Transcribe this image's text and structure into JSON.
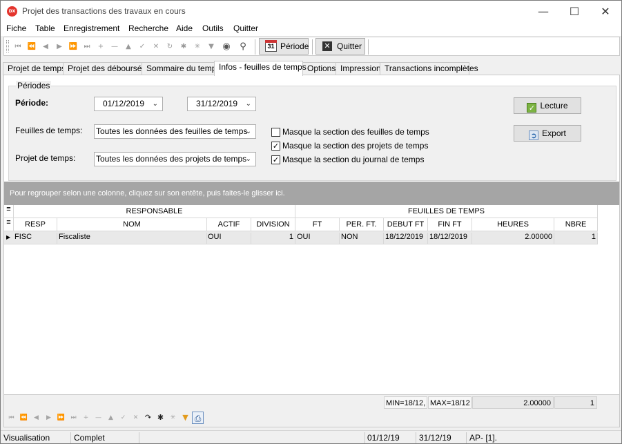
{
  "window": {
    "title": "Projet des transactions des travaux en cours",
    "icon_text": "DX"
  },
  "menu": [
    "Fiche",
    "Table",
    "Enregistrement",
    "Recherche",
    "Aide",
    "Outils",
    "Quitter"
  ],
  "toolbar": {
    "periode_label": "Période",
    "quitter_label": "Quitter",
    "calendar_day": "31"
  },
  "tabs": [
    "Projet de temps",
    "Projet des déboursés",
    "Sommaire du temps",
    "Infos - feuilles de temps",
    "Options",
    "Impression",
    "Transactions incomplètes"
  ],
  "active_tab": 3,
  "periodes": {
    "group_title": "Périodes",
    "periode_label": "Période:",
    "date_from": "01/12/2019",
    "date_to": "31/12/2019",
    "feuilles_label": "Feuilles de temps:",
    "feuilles_value": "Toutes les données des feuilles de temps",
    "projet_label": "Projet de temps:",
    "projet_value": "Toutes les données des projets de temps",
    "checkboxes": [
      {
        "label": "Masque la section des feuilles de temps",
        "checked": false
      },
      {
        "label": "Masque la section des projets de temps",
        "checked": true
      },
      {
        "label": "Masque la section du journal de temps",
        "checked": true
      }
    ],
    "lecture_label": "Lecture",
    "export_label": "Export"
  },
  "grid": {
    "group_hint": "Pour regrouper selon une colonne, cliquez sur son entête, puis faites-le glisser ici.",
    "bands": [
      "RESPONSABLE",
      "FEUILLES DE TEMPS"
    ],
    "columns": [
      "RESP",
      "NOM",
      "ACTIF",
      "DIVISION",
      "FT",
      "PER. FT.",
      "DEBUT FT",
      "FIN FT",
      "HEURES",
      "NBRE"
    ],
    "rows": [
      [
        "FISC",
        "Fiscaliste",
        "OUI",
        "1",
        "OUI",
        "NON",
        "18/12/2019",
        "18/12/2019",
        "2.00000",
        "1"
      ]
    ],
    "footer": {
      "min": "MIN=18/12,",
      "max": "MAX=18/12",
      "heures": "2.00000",
      "nbre": "1"
    }
  },
  "status": {
    "mode": "Visualisation",
    "state": "Complet",
    "date_from": "01/12/19",
    "date_to": "31/12/19",
    "ap": "AP- [1]."
  }
}
